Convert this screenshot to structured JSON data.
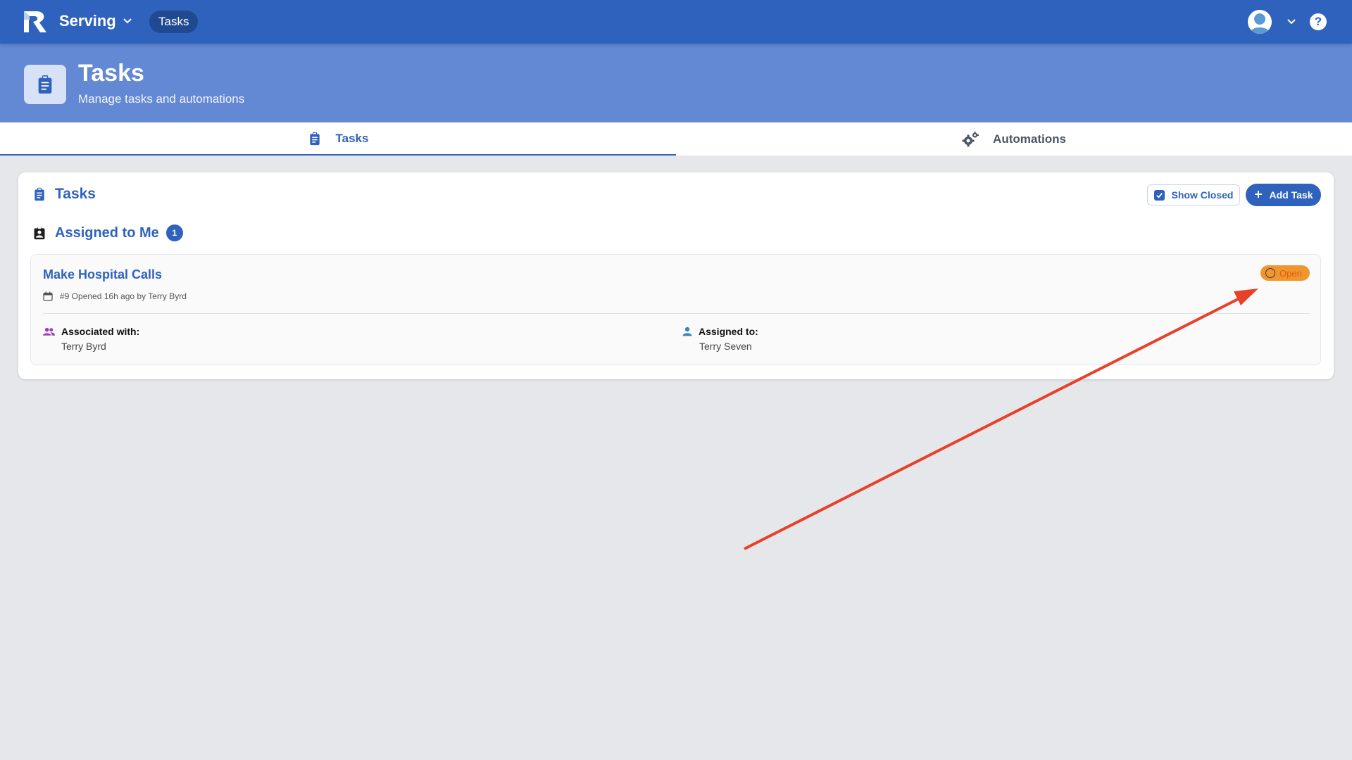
{
  "topbar": {
    "app_name": "Serving",
    "nav_pill": "Tasks",
    "logo_icon": "r-logo-icon",
    "help_icon": "help-icon",
    "help_glyph": "?"
  },
  "header": {
    "title": "Tasks",
    "subtitle": "Manage tasks and automations"
  },
  "tabs": [
    {
      "label": "Tasks",
      "icon": "clipboard-icon",
      "active": true
    },
    {
      "label": "Automations",
      "icon": "gears-icon",
      "active": false
    }
  ],
  "card": {
    "title": "Tasks",
    "show_closed_label": "Show Closed",
    "show_closed_checked": true,
    "add_task_label": "Add Task",
    "assigned_section": {
      "title": "Assigned to Me",
      "count": "1"
    },
    "task": {
      "title": "Make Hospital Calls",
      "meta": "#9 Opened 16h ago by Terry Byrd",
      "status": "Open",
      "associated_label": "Associated with:",
      "associated_value": "Terry Byrd",
      "assigned_label": "Assigned to:",
      "assigned_value": "Terry Seven"
    }
  },
  "colors": {
    "nav": "#2f62bd",
    "header": "#6388d4",
    "accent": "#2f62bd",
    "status_open": "#f0962e",
    "annotation_arrow": "#e8412a"
  }
}
